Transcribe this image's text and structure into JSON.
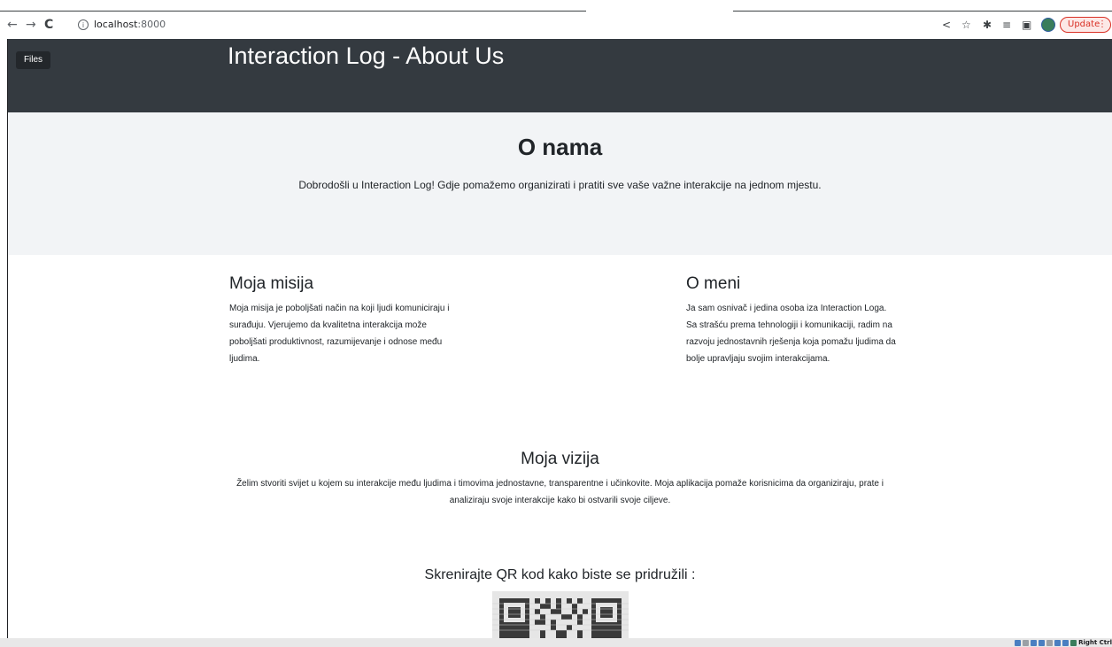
{
  "browser": {
    "back_icon": "arrow-left-icon",
    "forward_icon": "arrow-right-icon",
    "reload_icon": "reload-icon",
    "url_host": "localhost",
    "url_port": ":8000",
    "update_label": "Update"
  },
  "navbar": {
    "files_label": "Files",
    "brand": "Interaction Log - About Us"
  },
  "hero": {
    "title": "O nama",
    "text": "Dobrodošli u Interaction Log! Gdje pomažemo organizirati i pratiti sve vaše važne interakcije na jednom mjestu."
  },
  "mission": {
    "title": "Moja misija",
    "text": "Moja misija je poboljšati način na koji ljudi komuniciraju i surađuju. Vjerujemo da kvalitetna interakcija može poboljšati produktivnost, razumijevanje i odnose među ljudima."
  },
  "about_me": {
    "title": "O meni",
    "text": "Ja sam osnivač i jedina osoba iza Interaction Loga. Sa strašću prema tehnologiji i komunikaciji, radim na razvoju jednostavnih rješenja koja pomažu ljudima da bolje upravljaju svojim interakcijama."
  },
  "vision": {
    "title": "Moja vizija",
    "text": "Želim stvoriti svijet u kojem su interakcije među ljudima i timovima jednostavne, transparentne i učinkovite. Moja aplikacija pomaže korisnicima da organiziraju, prate i analiziraju svoje interakcije kako bi ostvarili svoje ciljeve."
  },
  "qr": {
    "title": "Skrenirajte QR kod kako biste se pridružili :"
  },
  "taskbar": {
    "tray_label": "Right Ctrl"
  },
  "colors": {
    "navbar_bg": "#343a40",
    "hero_bg": "#f2f4f6",
    "update_accent": "#d93025"
  }
}
